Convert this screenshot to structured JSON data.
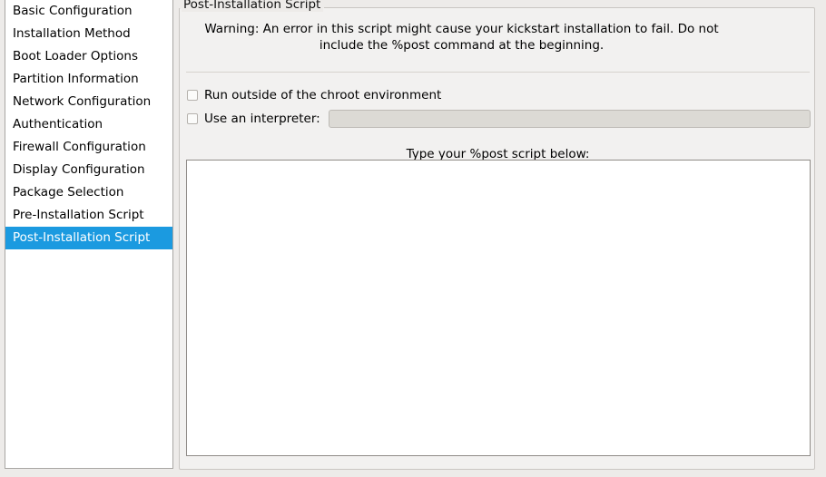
{
  "sidebar": {
    "items": [
      {
        "label": "Basic Configuration",
        "selected": false
      },
      {
        "label": "Installation Method",
        "selected": false
      },
      {
        "label": "Boot Loader Options",
        "selected": false
      },
      {
        "label": "Partition Information",
        "selected": false
      },
      {
        "label": "Network Configuration",
        "selected": false
      },
      {
        "label": "Authentication",
        "selected": false
      },
      {
        "label": "Firewall Configuration",
        "selected": false
      },
      {
        "label": "Display Configuration",
        "selected": false
      },
      {
        "label": "Package Selection",
        "selected": false
      },
      {
        "label": "Pre-Installation Script",
        "selected": false
      },
      {
        "label": "Post-Installation Script",
        "selected": true
      }
    ],
    "selected_index": 10
  },
  "panel": {
    "group_title": "Post-Installation Script",
    "warning_text": "Warning: An error in this script might cause your kickstart installation to fail. Do not include the %post command at the beginning.",
    "chroot_checkbox": {
      "label": "Run outside of the chroot environment",
      "checked": false
    },
    "interpreter_checkbox": {
      "label": "Use an interpreter:",
      "checked": false
    },
    "interpreter_input": {
      "value": "",
      "placeholder": "",
      "enabled": false
    },
    "script_label": "Type your %post script below:",
    "script_textarea": {
      "value": "",
      "placeholder": ""
    }
  },
  "colors": {
    "selection_blue": "#1b9ae0",
    "selection_text": "#ffffff",
    "window_background": "#edebe9",
    "panel_background": "#f2f1f0",
    "list_background": "#ffffff",
    "disabled_field": "#dcdad5",
    "border": "#c9c6c2",
    "text": "#000000"
  }
}
